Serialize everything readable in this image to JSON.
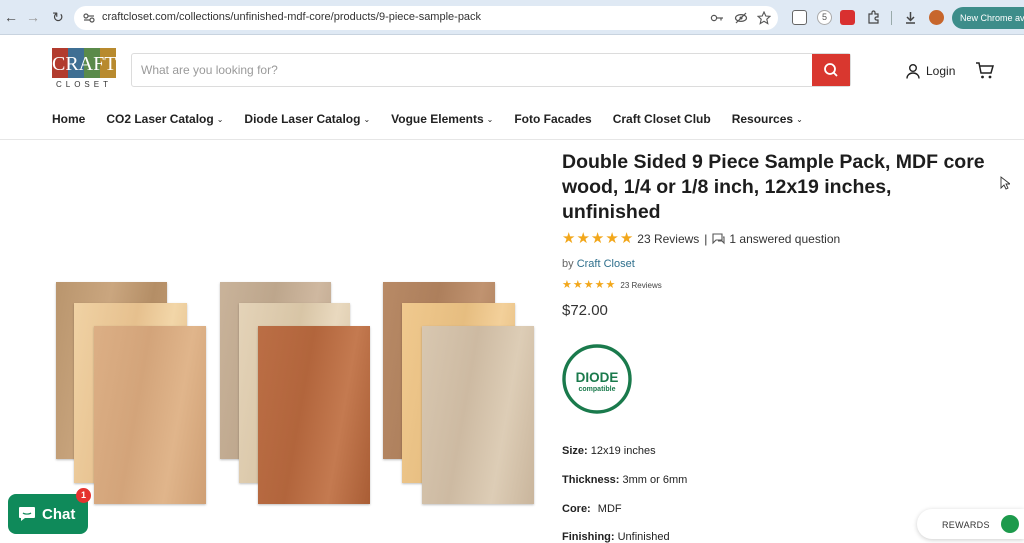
{
  "browser": {
    "url": "craftcloset.com/collections/unfinished-mdf-core/products/9-piece-sample-pack",
    "back_icon": "back-arrow-icon",
    "forward_icon": "forward-arrow-icon",
    "reload_icon": "reload-icon",
    "new_chrome_label": "New Chrome ava"
  },
  "header": {
    "logo_top": "CRAFT",
    "logo_bottom": "CLOSET",
    "search_placeholder": "What are you looking for?",
    "login_label": "Login"
  },
  "nav": {
    "items": [
      {
        "label": "Home",
        "dropdown": false
      },
      {
        "label": "CO2 Laser Catalog",
        "dropdown": true
      },
      {
        "label": "Diode Laser Catalog",
        "dropdown": true
      },
      {
        "label": "Vogue Elements",
        "dropdown": true
      },
      {
        "label": "Foto Facades",
        "dropdown": false
      },
      {
        "label": "Craft Closet Club",
        "dropdown": false
      },
      {
        "label": "Resources",
        "dropdown": true
      }
    ]
  },
  "product": {
    "title": "Double Sided 9 Piece Sample Pack, MDF core wood, 1/4 or 1/8 inch, 12x19 inches, unfinished",
    "rating_stars": 5,
    "reviews_label": "23 Reviews",
    "separator": "|",
    "questions_label": "1 answered question",
    "vendor_prefix": "by",
    "vendor": "Craft Closet",
    "reviews_label_small": "23 Reviews",
    "price": "$72.00",
    "badge_top": "DIODE",
    "badge_bottom": "compatible",
    "specs": [
      {
        "label": "Size:",
        "value": "12x19 inches"
      },
      {
        "label": "Thickness:",
        "value": "3mm or 6mm"
      },
      {
        "label": "Core:",
        "value": "MDF"
      },
      {
        "label": "Finishing:",
        "value": "Unfinished"
      }
    ]
  },
  "floating": {
    "chat_label": "Chat",
    "chat_count": "1",
    "rewards_label": "REWARDS"
  },
  "colors": {
    "brand_red": "#d9372f",
    "star": "#f2a71b",
    "badge_green": "#1a7a4c",
    "chat_green": "#0f8a5a"
  }
}
